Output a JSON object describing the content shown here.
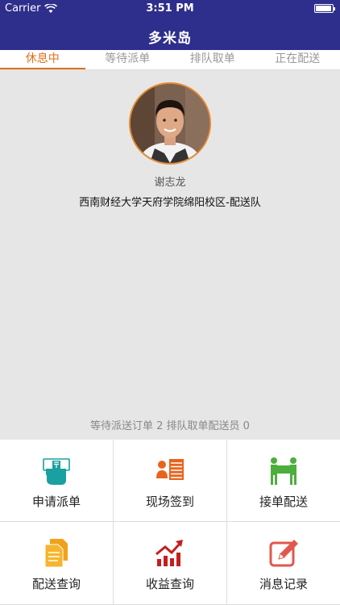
{
  "status": {
    "carrier": "Carrier",
    "time": "3:51 PM",
    "battery_level": 0.95
  },
  "nav": {
    "title": "多米岛"
  },
  "tabs": [
    {
      "label": "休息中",
      "active": true
    },
    {
      "label": "等待派单",
      "active": false
    },
    {
      "label": "排队取单",
      "active": false
    },
    {
      "label": "正在配送",
      "active": false
    }
  ],
  "profile": {
    "name": "谢志龙",
    "team": "西南财经大学天府学院绵阳校区-配送队"
  },
  "counts": "等待派送订单 2  排队取单配送员 0",
  "menu": [
    {
      "label": "申请派单",
      "icon": "hand-ticket-icon"
    },
    {
      "label": "现场签到",
      "icon": "person-list-icon"
    },
    {
      "label": "接单配送",
      "icon": "handover-icon"
    },
    {
      "label": "配送查询",
      "icon": "documents-icon"
    },
    {
      "label": "收益查询",
      "icon": "growth-chart-icon"
    },
    {
      "label": "消息记录",
      "icon": "edit-note-icon"
    }
  ],
  "colors": {
    "nav_bg": "#2e2e8c",
    "accent": "#e0701e",
    "content_bg": "#e6e6e6"
  }
}
